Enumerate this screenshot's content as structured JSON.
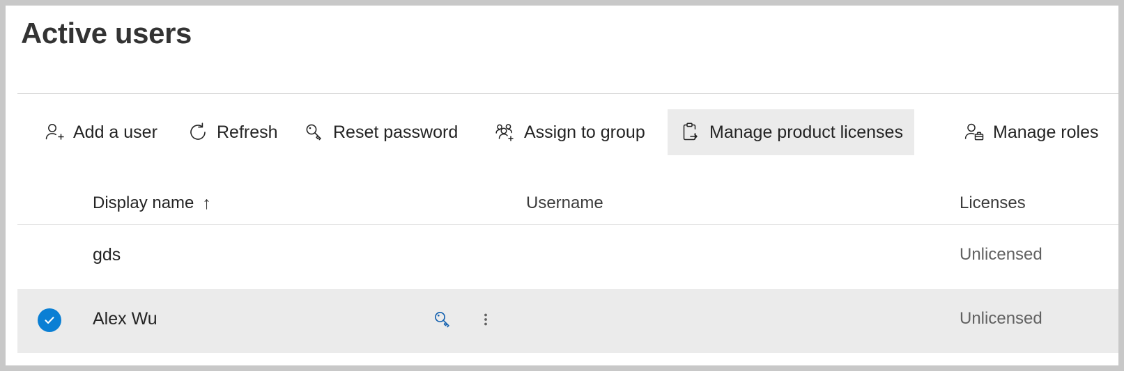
{
  "page": {
    "title": "Active users"
  },
  "command_bar": {
    "items": [
      {
        "label": "Add a user",
        "icon": "add-user-icon",
        "selected": false
      },
      {
        "label": "Refresh",
        "icon": "refresh-icon",
        "selected": false
      },
      {
        "label": "Reset password",
        "icon": "key-icon",
        "selected": false
      },
      {
        "label": "Assign to group",
        "icon": "add-group-icon",
        "selected": false
      },
      {
        "label": "Manage product licenses",
        "icon": "clipboard-arrow-icon",
        "selected": true
      },
      {
        "label": "Manage roles",
        "icon": "user-briefcase-icon",
        "selected": false
      }
    ]
  },
  "table": {
    "columns": {
      "display_name": "Display name",
      "username": "Username",
      "licenses": "Licenses"
    },
    "sort": {
      "column": "Display name",
      "direction_glyph": "↑"
    },
    "rows": [
      {
        "display_name": "gds",
        "username": "",
        "licenses": "Unlicensed",
        "selected": false,
        "checked": false,
        "show_actions": false
      },
      {
        "display_name": "Alex Wu",
        "username": "",
        "licenses": "Unlicensed",
        "selected": true,
        "checked": true,
        "show_actions": true,
        "actions": [
          {
            "name": "reset-password-icon",
            "title": "Reset password"
          },
          {
            "name": "more-options-icon",
            "title": "More options"
          }
        ]
      }
    ]
  },
  "colors": {
    "accent_blue": "#0a7fd4",
    "selected_row_bg": "#ebebeb",
    "frame_border": "#c8c8c8",
    "text_primary": "#242424",
    "text_muted": "#616161"
  }
}
